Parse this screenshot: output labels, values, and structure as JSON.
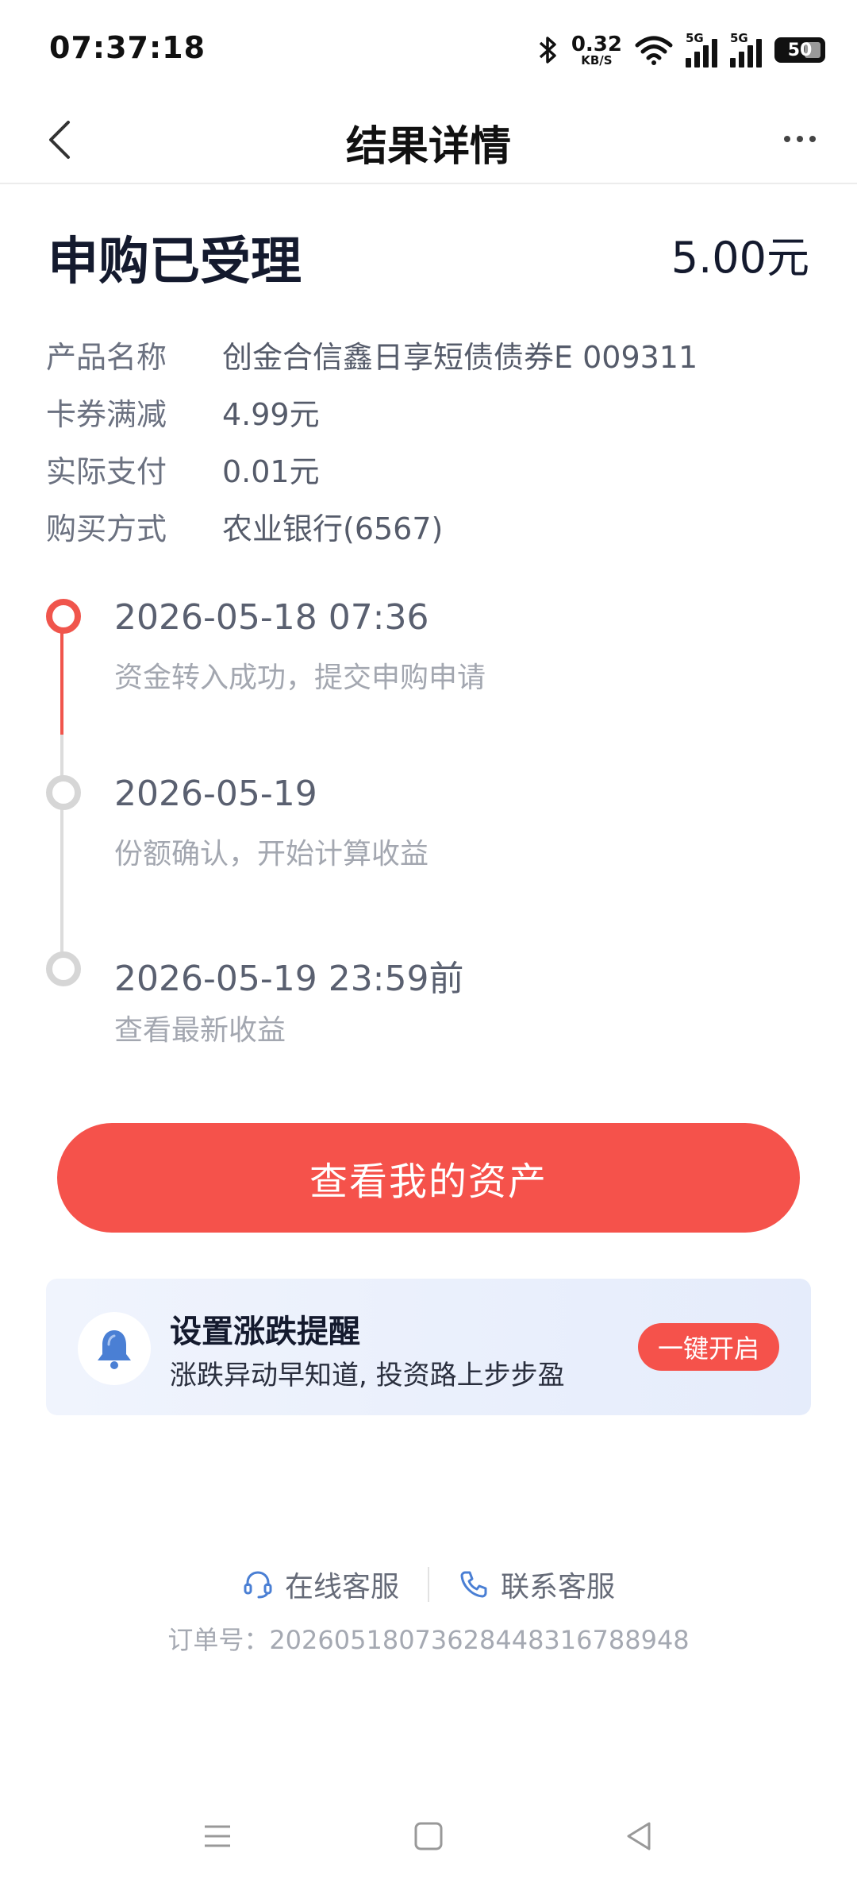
{
  "status_bar": {
    "time": "07:37:18",
    "net_speed_value": "0.32",
    "net_speed_unit": "KB/S",
    "signal_1_tag": "5G",
    "signal_2_tag": "5G",
    "battery": "50"
  },
  "navbar": {
    "title": "结果详情"
  },
  "result": {
    "status_title": "申购已受理",
    "amount": "5.00元",
    "details": [
      {
        "label": "产品名称",
        "value": "创金合信鑫日享短债债券E 009311"
      },
      {
        "label": "卡券满减",
        "value": "4.99元"
      },
      {
        "label": "实际支付",
        "value": "0.01元"
      },
      {
        "label": "购买方式",
        "value": "农业银行(6567)"
      }
    ]
  },
  "timeline": [
    {
      "date": "2026-05-18 07:36",
      "desc": "资金转入成功，提交申购申请",
      "active": true
    },
    {
      "date": "2026-05-19",
      "desc": "份额确认，开始计算收益",
      "active": false
    },
    {
      "date": "2026-05-19 23:59前",
      "desc": "查看最新收益",
      "active": false
    }
  ],
  "primary_button": "查看我的资产",
  "reminder_card": {
    "title": "设置涨跌提醒",
    "subtitle": "涨跌异动早知道, 投资路上步步盈",
    "button": "一键开启"
  },
  "footer": {
    "online_service": "在线客服",
    "contact_service": "联系客服",
    "order_number": "订单号：2026051807362844831678894​8"
  },
  "colors": {
    "accent": "#f5524b",
    "icon_blue": "#4a7fd4"
  }
}
